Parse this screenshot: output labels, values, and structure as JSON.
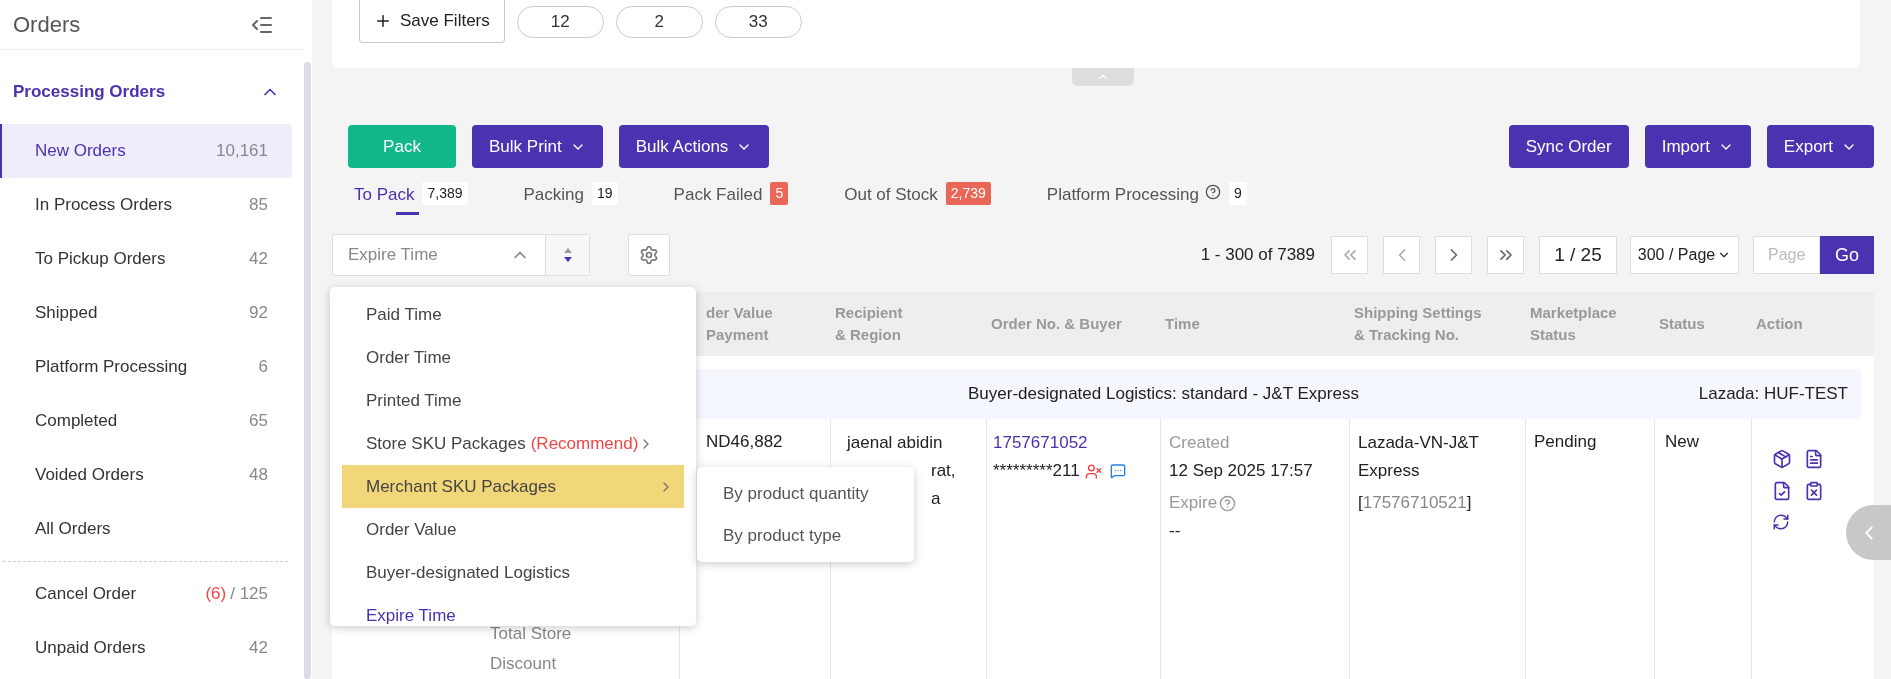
{
  "sidebar": {
    "title": "Orders",
    "section": {
      "label": "Processing Orders",
      "expanded": true
    },
    "items": [
      {
        "label": "New Orders",
        "count": "10,161",
        "selected": true
      },
      {
        "label": "In Process Orders",
        "count": "85",
        "selected": false
      },
      {
        "label": "To Pickup Orders",
        "count": "42",
        "selected": false
      },
      {
        "label": "Shipped",
        "count": "92",
        "selected": false
      },
      {
        "label": "Platform Processing",
        "count": "6",
        "selected": false
      },
      {
        "label": "Completed",
        "count": "65",
        "selected": false
      },
      {
        "label": "Voided Orders",
        "count": "48",
        "selected": false
      },
      {
        "label": "All Orders",
        "selected": false
      }
    ],
    "other_items": [
      {
        "label": "Cancel Order",
        "alert": "(6)",
        "count": "/ 125",
        "selected": false
      },
      {
        "label": "Unpaid Orders",
        "count": "42",
        "selected": false
      }
    ]
  },
  "filters": {
    "save_button": "Save Filters",
    "saved": [
      "12",
      "2",
      "33"
    ]
  },
  "toolbar": {
    "left": [
      {
        "label": "Pack",
        "kind": "primary"
      },
      {
        "label": "Bulk Print",
        "kind": "menu"
      },
      {
        "label": "Bulk Actions",
        "kind": "menu"
      }
    ],
    "right": [
      {
        "label": "Sync Order",
        "kind": "plain"
      },
      {
        "label": "Import",
        "kind": "menu"
      },
      {
        "label": "Export",
        "kind": "menu"
      }
    ]
  },
  "tabs": [
    {
      "label": "To Pack",
      "count": "7,389",
      "alert": false,
      "help": false,
      "selected": true
    },
    {
      "label": "Packing",
      "count": "19",
      "alert": false,
      "help": false,
      "selected": false
    },
    {
      "label": "Pack Failed",
      "count": "5",
      "alert": true,
      "help": false,
      "selected": false
    },
    {
      "label": "Out of Stock",
      "count": "2,739",
      "alert": true,
      "help": false,
      "selected": false
    },
    {
      "label": "Platform Processing",
      "count": "9",
      "alert": false,
      "help": true,
      "selected": false
    }
  ],
  "sort": {
    "value": "Expire Time",
    "expanded": true
  },
  "pagination": {
    "range": "1 - 300 of 7389",
    "page": "1 / 25",
    "page_size": "300 / Page",
    "page_placeholder": "Page",
    "go": "Go"
  },
  "table": {
    "columns": [
      [],
      [
        "der Value",
        "Payment"
      ],
      [
        "Recipient",
        "& Region"
      ],
      [
        "Order No. & Buyer"
      ],
      [
        "Time"
      ],
      [
        "Shipping Settings",
        "& Tracking No."
      ],
      [
        "Marketplace",
        "Status"
      ],
      [
        "Status"
      ],
      [
        "Action"
      ]
    ],
    "group": {
      "logistics": "Buyer-designated Logistics: standard - J&T Express",
      "store": "Lazada: HUF-TEST"
    },
    "row": {
      "discount_label": "Total Store Discount",
      "value": "ND46,882",
      "recipient": [
        "jaenal abidin",
        "rat,",
        "a"
      ],
      "order_no": "1757671052",
      "buyer": "*********211",
      "created_label": "Created",
      "created": "12 Sep 2025 17:57",
      "expire_label": "Expire",
      "expire": "--",
      "carrier": "Lazada-VN-J&T Express",
      "tracking_open": "[",
      "tracking": "17576710521",
      "tracking_close": "]",
      "marketplace_status": "Pending",
      "status": "New"
    }
  },
  "sort_menu": {
    "items": [
      {
        "label": "Paid Time",
        "submenu": false,
        "highlighted": false,
        "selected": false
      },
      {
        "label": "Order Time",
        "submenu": false,
        "highlighted": false,
        "selected": false
      },
      {
        "label": "Printed Time",
        "submenu": false,
        "highlighted": false,
        "selected": false
      },
      {
        "label": "Store SKU Packages",
        "note": "(Recommend)",
        "submenu": true,
        "highlighted": false,
        "selected": false
      },
      {
        "label": "Merchant SKU Packages",
        "submenu": true,
        "highlighted": true,
        "selected": false
      },
      {
        "label": "Order Value",
        "submenu": false,
        "highlighted": false,
        "selected": false
      },
      {
        "label": "Buyer-designated Logistics",
        "submenu": false,
        "highlighted": false,
        "selected": false
      },
      {
        "label": "Expire Time",
        "submenu": false,
        "highlighted": false,
        "selected": true
      }
    ],
    "submenu": [
      "By product quantity",
      "By product type"
    ]
  }
}
